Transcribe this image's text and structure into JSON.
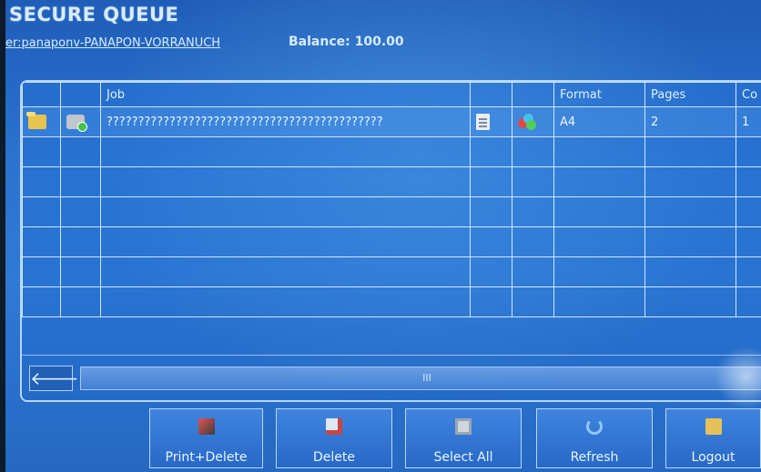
{
  "header": {
    "title": "SECURE QUEUE",
    "user": "er:panaponv-PANAPON-VORRANUCH",
    "balance": "Balance: 100.00"
  },
  "table": {
    "columns": [
      "",
      "",
      "Job",
      "",
      "",
      "Format",
      "Pages",
      "Co"
    ],
    "rows": [
      {
        "icon1": "folder-icon",
        "icon2": "printer-ready-icon",
        "job": "????????????????????????????????????????????",
        "icon3": "document-icon",
        "icon4": "color-icon",
        "format": "A4",
        "pages": "2",
        "copies": "1"
      }
    ],
    "empty_rows": 6
  },
  "scroll": {
    "left_arrow": "🡐",
    "thumb_label": "III"
  },
  "toolbar": {
    "print_delete": "Print+Delete",
    "delete": "Delete",
    "select_all": "Select All",
    "refresh": "Refresh",
    "logout": "Logout"
  }
}
